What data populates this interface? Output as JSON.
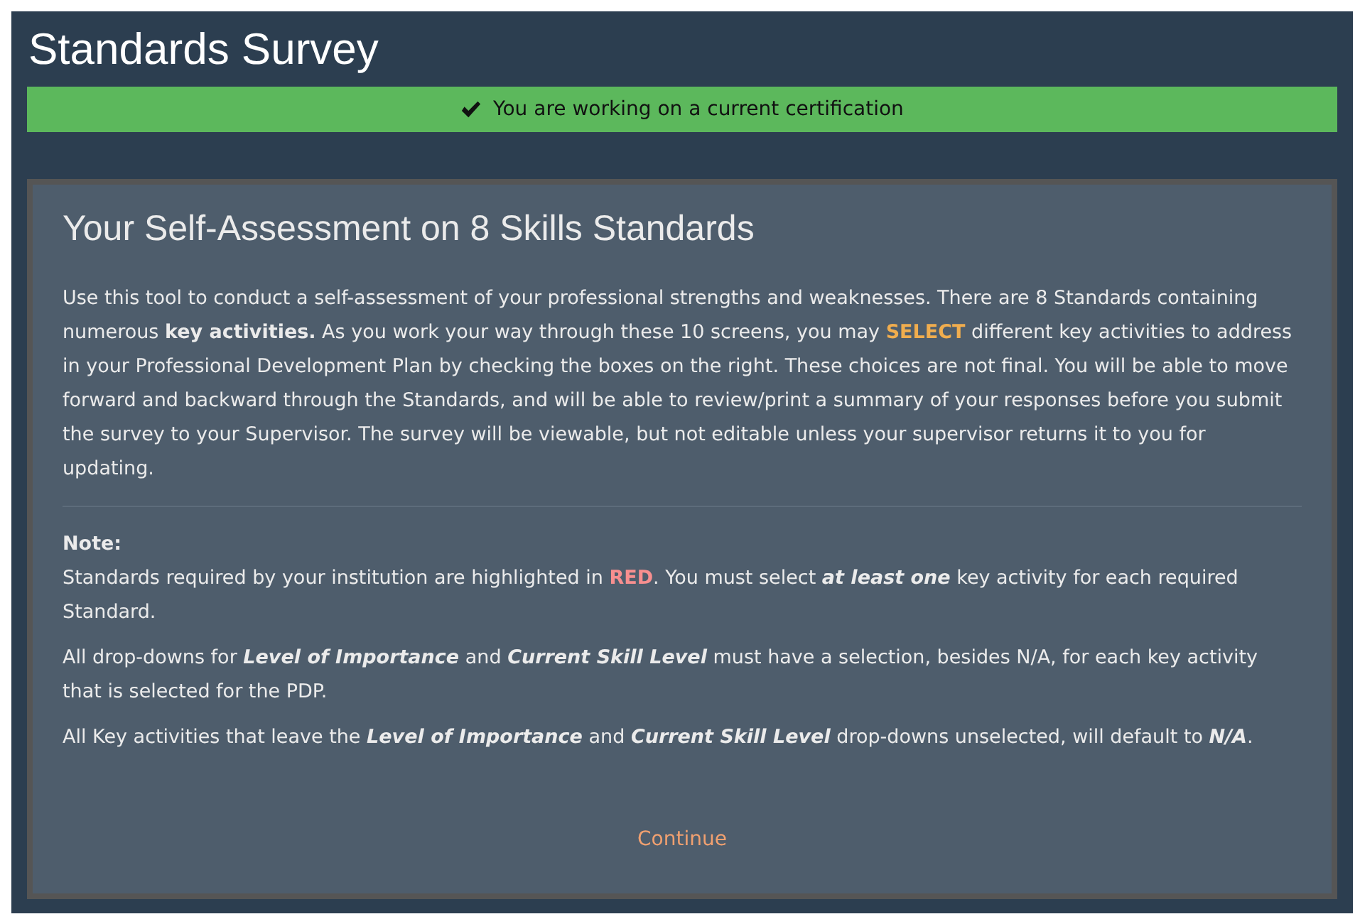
{
  "page_title": "Standards Survey",
  "alert": {
    "kind": "success",
    "text": "You are working on a current certification"
  },
  "panel": {
    "heading": "Your Self-Assessment on 8 Skills Standards",
    "intro": [
      {
        "kind": "plain",
        "text": "Use this tool to conduct a self-assessment of your professional strengths and weaknesses. There are 8 Standards containing numerous "
      },
      {
        "kind": "bold",
        "text": "key activities."
      },
      {
        "kind": "plain",
        "text": " As you work your way through these 10 screens, you may "
      },
      {
        "kind": "orange",
        "text": "SELECT"
      },
      {
        "kind": "plain",
        "text": " different key activities to address in your Professional Development Plan by checking the boxes on the right. These choices are not final. You will be able to move forward and backward through the Standards, and will be able to review/print a summary of your responses before you submit the survey to your Supervisor. The survey will be viewable, but not editable unless your supervisor returns it to you for updating."
      }
    ],
    "note_label": "Note:",
    "notes": [
      [
        {
          "kind": "plain",
          "text": "Standards required by your institution are highlighted in "
        },
        {
          "kind": "red",
          "text": "RED"
        },
        {
          "kind": "plain",
          "text": ". You must select "
        },
        {
          "kind": "emphasis",
          "text": "at least one"
        },
        {
          "kind": "plain",
          "text": " key activity for each required Standard."
        }
      ],
      [
        {
          "kind": "plain",
          "text": "All drop-downs for "
        },
        {
          "kind": "emphasis",
          "text": "Level of Importance"
        },
        {
          "kind": "plain",
          "text": " and "
        },
        {
          "kind": "emphasis",
          "text": "Current Skill Level"
        },
        {
          "kind": "plain",
          "text": " must have a selection, besides N/A, for each key activity that is selected for the PDP."
        }
      ],
      [
        {
          "kind": "plain",
          "text": "All Key activities that leave the "
        },
        {
          "kind": "emphasis",
          "text": "Level of Importance"
        },
        {
          "kind": "plain",
          "text": " and "
        },
        {
          "kind": "emphasis",
          "text": "Current Skill Level"
        },
        {
          "kind": "plain",
          "text": " drop-downs unselected, will default to "
        },
        {
          "kind": "emphasis",
          "text": "N/A"
        },
        {
          "kind": "plain",
          "text": "."
        }
      ]
    ],
    "continue_link": "Continue"
  }
}
